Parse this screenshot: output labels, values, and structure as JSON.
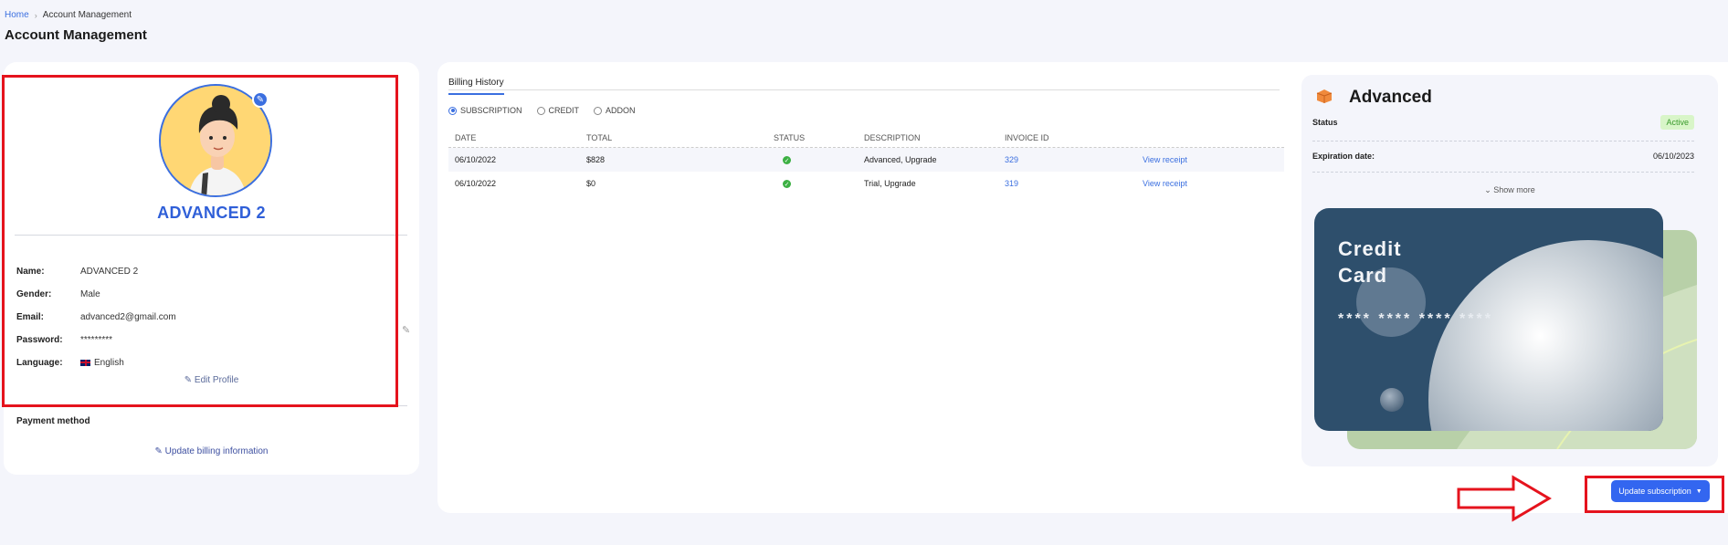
{
  "breadcrumb": {
    "home": "Home",
    "separator": "›",
    "current": "Account Management"
  },
  "page_title": "Account Management",
  "profile": {
    "name": "ADVANCED 2",
    "fields": [
      {
        "label": "Name:",
        "value": "ADVANCED 2"
      },
      {
        "label": "Gender:",
        "value": "Male"
      },
      {
        "label": "Email:",
        "value": "advanced2@gmail.com"
      },
      {
        "label": "Password:",
        "value": "*********"
      },
      {
        "label": "Language:",
        "value": "English",
        "icon": "uk-flag-icon"
      }
    ],
    "edit_profile": "Edit Profile",
    "payment_method_label": "Payment method",
    "update_billing": "Update billing information"
  },
  "billing": {
    "tab": "Billing History",
    "filters": [
      {
        "label": "SUBSCRIPTION",
        "selected": true
      },
      {
        "label": "CREDIT",
        "selected": false
      },
      {
        "label": "ADDON",
        "selected": false
      }
    ],
    "columns": [
      "DATE",
      "TOTAL",
      "STATUS",
      "DESCRIPTION",
      "INVOICE ID",
      ""
    ],
    "rows": [
      {
        "date": "06/10/2022",
        "total": "$828",
        "status": "check-circle-icon",
        "description": "Advanced, Upgrade",
        "invoice_id": "329",
        "action": "View receipt"
      },
      {
        "date": "06/10/2022",
        "total": "$0",
        "status": "check-circle-icon",
        "description": "Trial, Upgrade",
        "invoice_id": "319",
        "action": "View receipt"
      }
    ]
  },
  "plan": {
    "name": "Advanced",
    "status_label": "Status",
    "status_value": "Active",
    "expiration_label": "Expiration date:",
    "expiration_value": "06/10/2023",
    "show_more": "Show more",
    "card": {
      "title_line1": "Credit",
      "title_line2": "Card",
      "number": "**** **** **** ****"
    }
  },
  "update_subscription": "Update subscription",
  "colors": {
    "accent": "#3b6fe0",
    "highlight": "#e5131d",
    "active_badge_bg": "#d8f5c8",
    "card_bg": "#2e4f6c"
  }
}
